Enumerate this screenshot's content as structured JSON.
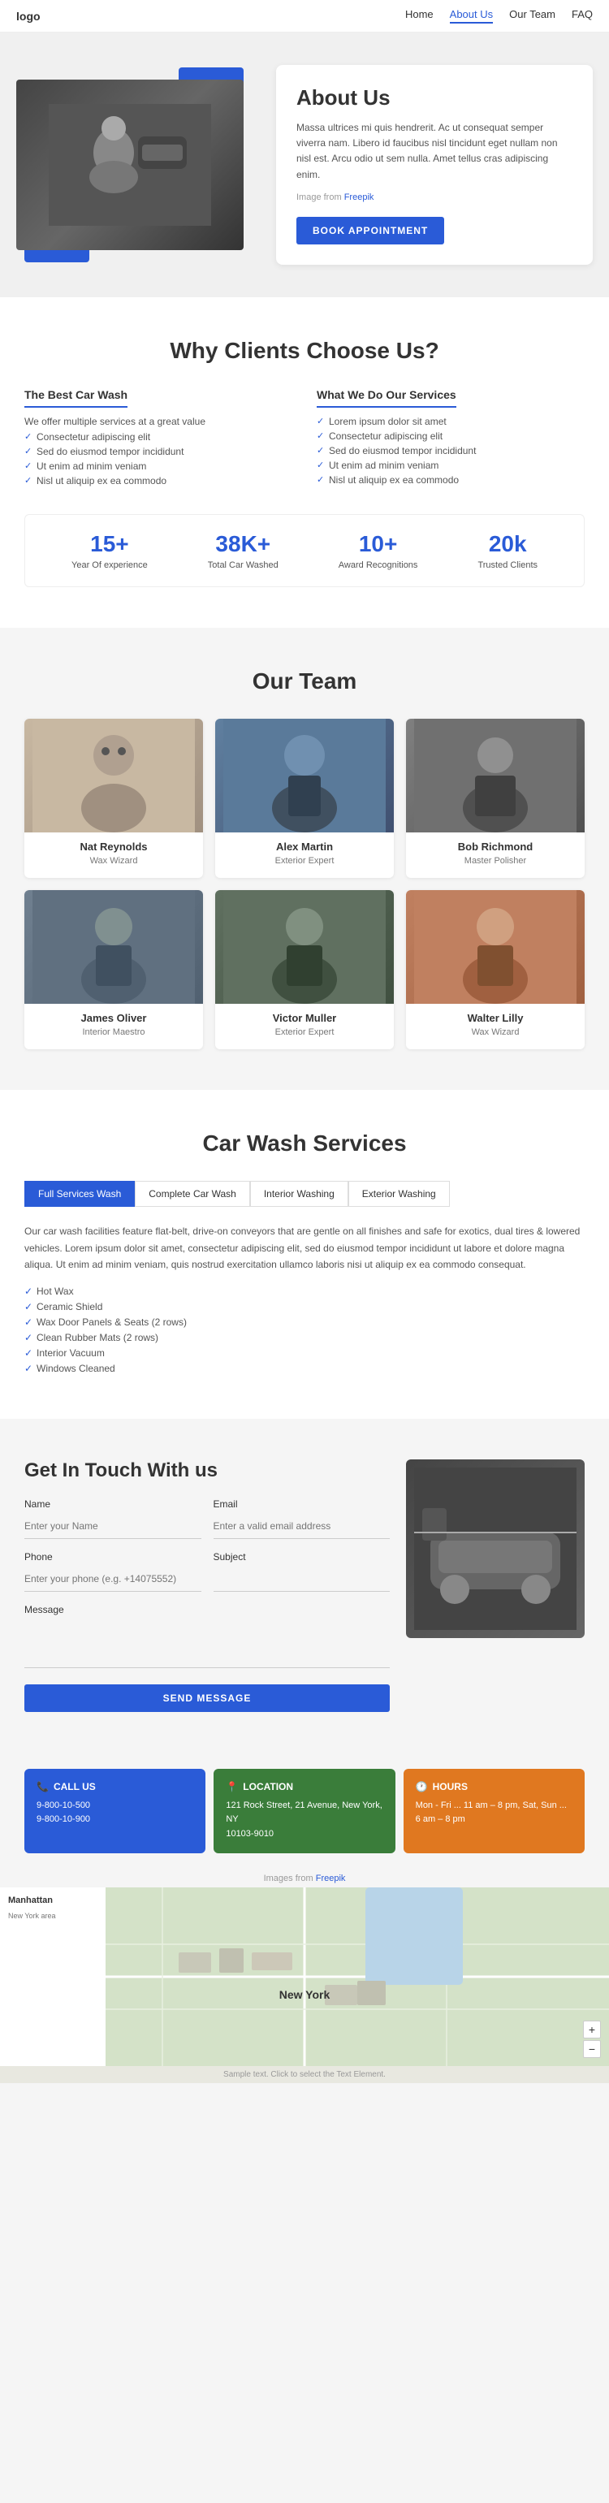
{
  "nav": {
    "logo": "logo",
    "links": [
      {
        "label": "Home",
        "active": false
      },
      {
        "label": "About Us",
        "active": true
      },
      {
        "label": "Our Team",
        "active": false
      },
      {
        "label": "FAQ",
        "active": false
      }
    ]
  },
  "hero": {
    "title": "About Us",
    "description": "Massa ultrices mi quis hendrerit. Ac ut consequat semper viverra nam. Libero id faucibus nisl tincidunt eget nullam non nisl est. Arcu odio ut sem nulla. Amet tellus cras adipiscing enim.",
    "image_credit_text": "Image from",
    "image_credit_link": "Freepik",
    "book_btn": "BOOK APPOINTMENT"
  },
  "why": {
    "section_title": "Why Clients Choose Us?",
    "col1": {
      "heading": "The Best Car Wash",
      "intro": "We offer multiple services at a great value",
      "items": [
        "Consectetur adipiscing elit",
        "Sed do eiusmod tempor incididunt",
        "Ut enim ad minim veniam",
        "Nisl ut aliquip ex ea commodo"
      ]
    },
    "col2": {
      "heading": "What We Do Our Services",
      "items": [
        "Lorem ipsum dolor sit amet",
        "Consectetur adipiscing elit",
        "Sed do eiusmod tempor incididunt",
        "Ut enim ad minim veniam",
        "Nisl ut aliquip ex ea commodo"
      ]
    },
    "stats": [
      {
        "number": "15+",
        "label": "Year Of experience"
      },
      {
        "number": "38K+",
        "label": "Total Car Washed"
      },
      {
        "number": "10+",
        "label": "Award Recognitions"
      },
      {
        "number": "20k",
        "label": "Trusted Clients"
      }
    ]
  },
  "team": {
    "section_title": "Our Team",
    "members": [
      {
        "name": "Nat Reynolds",
        "role": "Wax Wizard",
        "photo_class": "photo-nat"
      },
      {
        "name": "Alex Martin",
        "role": "Exterior Expert",
        "photo_class": "photo-alex"
      },
      {
        "name": "Bob Richmond",
        "role": "Master Polisher",
        "photo_class": "photo-bob"
      },
      {
        "name": "James Oliver",
        "role": "Interior Maestro",
        "photo_class": "photo-james"
      },
      {
        "name": "Victor Muller",
        "role": "Exterior Expert",
        "photo_class": "photo-victor"
      },
      {
        "name": "Walter Lilly",
        "role": "Wax Wizard",
        "photo_class": "photo-walter"
      }
    ]
  },
  "services": {
    "section_title": "Car Wash Services",
    "tabs": [
      {
        "label": "Full Services Wash",
        "active": true
      },
      {
        "label": "Complete Car Wash",
        "active": false
      },
      {
        "label": "Interior Washing",
        "active": false
      },
      {
        "label": "Exterior Washing",
        "active": false
      }
    ],
    "content_text": "Our car wash facilities feature flat-belt, drive-on conveyors that are gentle on all finishes and safe for exotics, dual tires & lowered vehicles. Lorem ipsum dolor sit amet, consectetur adipiscing elit, sed do eiusmod tempor incididunt ut labore et dolore magna aliqua. Ut enim ad minim veniam, quis nostrud exercitation ullamco laboris nisi ut aliquip ex ea commodo consequat.",
    "features": [
      "Hot Wax",
      "Ceramic Shield",
      "Wax Door Panels & Seats (2 rows)",
      "Clean Rubber Mats (2 rows)",
      "Interior Vacuum",
      "Windows Cleaned"
    ]
  },
  "contact": {
    "section_title": "Get In Touch With us",
    "fields": {
      "name_label": "Name",
      "name_placeholder": "Enter your Name",
      "email_label": "Email",
      "email_placeholder": "Enter a valid email address",
      "phone_label": "Phone",
      "phone_placeholder": "Enter your phone (e.g. +14075552)",
      "subject_label": "Subject",
      "subject_placeholder": "",
      "message_label": "Message"
    },
    "send_btn": "SEND MESSAGE"
  },
  "info_cards": [
    {
      "type": "blue",
      "icon": "📞",
      "heading": "CALL US",
      "lines": [
        "9-800-10-500",
        "9-800-10-900"
      ]
    },
    {
      "type": "green",
      "icon": "📍",
      "heading": "LOCATION",
      "lines": [
        "121 Rock Street, 21 Avenue, New York, NY",
        "10103-9010"
      ]
    },
    {
      "type": "orange",
      "icon": "🕐",
      "heading": "HOURS",
      "lines": [
        "Mon - Fri ... 11 am – 8 pm, Sat, Sun ...",
        "6 am – 8 pm"
      ]
    }
  ],
  "map": {
    "city_label": "New York",
    "sidebar_title": "Manhattan",
    "zoom_in": "+",
    "zoom_out": "−"
  },
  "footer": {
    "note": "Sample text. Click to select the Text Element."
  }
}
